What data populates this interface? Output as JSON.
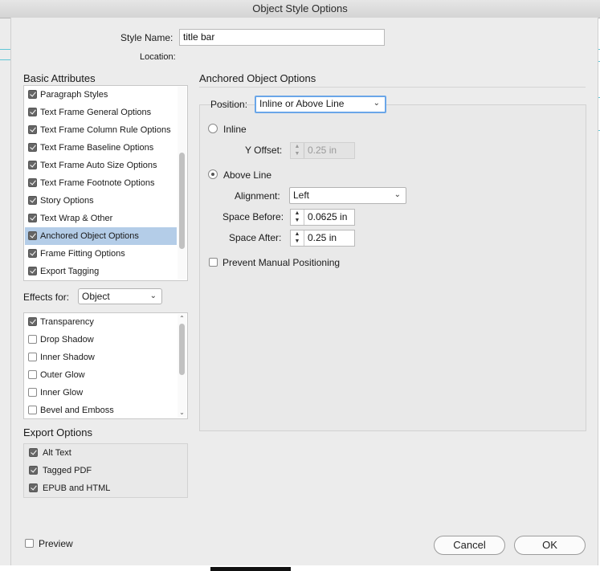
{
  "window": {
    "title": "Object Style Options"
  },
  "style_name": {
    "label": "Style Name:",
    "value": "title bar"
  },
  "location": {
    "label": "Location:"
  },
  "basic_attributes": {
    "title": "Basic Attributes",
    "items": [
      {
        "label": "Paragraph Styles",
        "checked": true
      },
      {
        "label": "Text Frame General Options",
        "checked": true
      },
      {
        "label": "Text Frame Column Rule Options",
        "checked": true
      },
      {
        "label": "Text Frame Baseline Options",
        "checked": true
      },
      {
        "label": "Text Frame Auto Size Options",
        "checked": true
      },
      {
        "label": "Text Frame Footnote Options",
        "checked": true
      },
      {
        "label": "Story Options",
        "checked": true
      },
      {
        "label": "Text Wrap & Other",
        "checked": true
      },
      {
        "label": "Anchored Object Options",
        "checked": true,
        "selected": true
      },
      {
        "label": "Frame Fitting Options",
        "checked": true
      },
      {
        "label": "Export Tagging",
        "checked": true
      }
    ]
  },
  "effects": {
    "label": "Effects for:",
    "selected": "Object",
    "items": [
      {
        "label": "Transparency",
        "checked": true
      },
      {
        "label": "Drop Shadow",
        "checked": false
      },
      {
        "label": "Inner Shadow",
        "checked": false
      },
      {
        "label": "Outer Glow",
        "checked": false
      },
      {
        "label": "Inner Glow",
        "checked": false
      },
      {
        "label": "Bevel and Emboss",
        "checked": false
      }
    ]
  },
  "export_options": {
    "title": "Export Options",
    "items": [
      {
        "label": "Alt Text",
        "checked": true
      },
      {
        "label": "Tagged PDF",
        "checked": true
      },
      {
        "label": "EPUB and HTML",
        "checked": true
      }
    ]
  },
  "anchored": {
    "title": "Anchored Object Options",
    "position_label": "Position:",
    "position_value": "Inline or Above Line",
    "inline_label": "Inline",
    "inline_selected": false,
    "y_offset_label": "Y Offset:",
    "y_offset_value": "0.25 in",
    "above_line_label": "Above Line",
    "above_line_selected": true,
    "alignment_label": "Alignment:",
    "alignment_value": "Left",
    "space_before_label": "Space Before:",
    "space_before_value": "0.0625 in",
    "space_after_label": "Space After:",
    "space_after_value": "0.25 in",
    "prevent_label": "Prevent Manual Positioning",
    "prevent_checked": false
  },
  "footer": {
    "preview_label": "Preview",
    "preview_checked": false,
    "cancel_label": "Cancel",
    "ok_label": "OK"
  },
  "colors": {
    "selection": "#b4cde8",
    "focus_ring": "#6aa6e8",
    "guide": "#5fc6d6"
  },
  "icons": {
    "checkbox": "checkmark-icon",
    "dropdown": "chevron-down-icon",
    "stepper": "stepper-arrows-icon"
  }
}
